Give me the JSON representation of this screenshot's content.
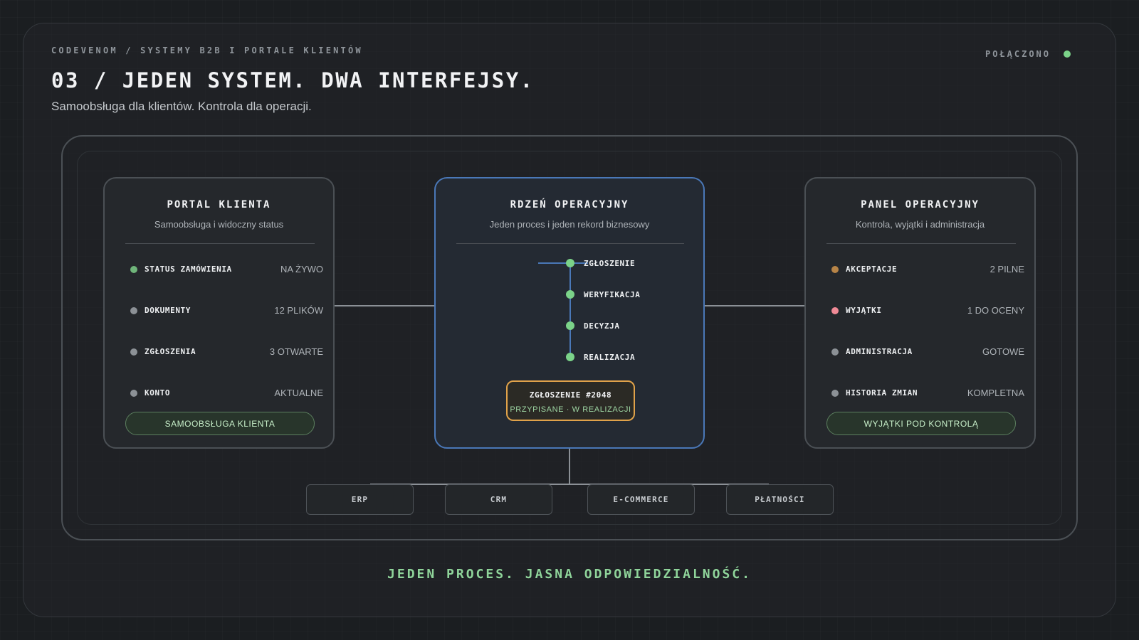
{
  "header": {
    "breadcrumb": "CODEVENOM / SYSTEMY B2B I PORTALE KLIENTÓW",
    "status": "POŁĄCZONO",
    "title": "03 / JEDEN SYSTEM. DWA INTERFEJSY.",
    "subtitle": "Samoobsługa dla klientów. Kontrola dla operacji."
  },
  "colors": {
    "accent_green": "#7bd389",
    "accent_blue": "#4a78b8",
    "accent_orange": "#e0a24a",
    "warning_brown": "#b78447",
    "alert_pink": "#f08a96",
    "neutral_gray": "#8c9196"
  },
  "portal": {
    "title": "PORTAL KLIENTA",
    "subtitle": "Samoobsługa i widoczny status",
    "rows": [
      {
        "label": "STATUS ZAMÓWIENIA",
        "value": "NA ŻYWO",
        "dot": "#6fb57a"
      },
      {
        "label": "DOKUMENTY",
        "value": "12 PLIKÓW",
        "dot": "#8c9196"
      },
      {
        "label": "ZGŁOSZENIA",
        "value": "3 OTWARTE",
        "dot": "#8c9196"
      },
      {
        "label": "KONTO",
        "value": "AKTUALNE",
        "dot": "#8c9196"
      }
    ],
    "pill": "SAMOOBSŁUGA KLIENTA"
  },
  "core": {
    "title": "RDZEŃ OPERACYJNY",
    "subtitle": "Jeden proces i jeden rekord biznesowy",
    "steps": [
      "ZGŁOSZENIE",
      "WERYFIKACJA",
      "DECYZJA",
      "REALIZACJA"
    ],
    "ticket": {
      "title": "ZGŁOSZENIE #2048",
      "status": "PRZYPISANE · W REALIZACJI"
    }
  },
  "ops": {
    "title": "PANEL OPERACYJNY",
    "subtitle": "Kontrola, wyjątki i administracja",
    "rows": [
      {
        "label": "AKCEPTACJE",
        "value": "2 PILNE",
        "dot": "#b78447"
      },
      {
        "label": "WYJĄTKI",
        "value": "1 DO OCENY",
        "dot": "#f08a96"
      },
      {
        "label": "ADMINISTRACJA",
        "value": "GOTOWE",
        "dot": "#8c9196"
      },
      {
        "label": "HISTORIA ZMIAN",
        "value": "KOMPLETNA",
        "dot": "#8c9196"
      }
    ],
    "pill": "WYJĄTKI POD KONTROLĄ"
  },
  "integrations": [
    "ERP",
    "CRM",
    "E-COMMERCE",
    "PŁATNOŚCI"
  ],
  "footer": "JEDEN PROCES. JASNA ODPOWIEDZIALNOŚĆ."
}
